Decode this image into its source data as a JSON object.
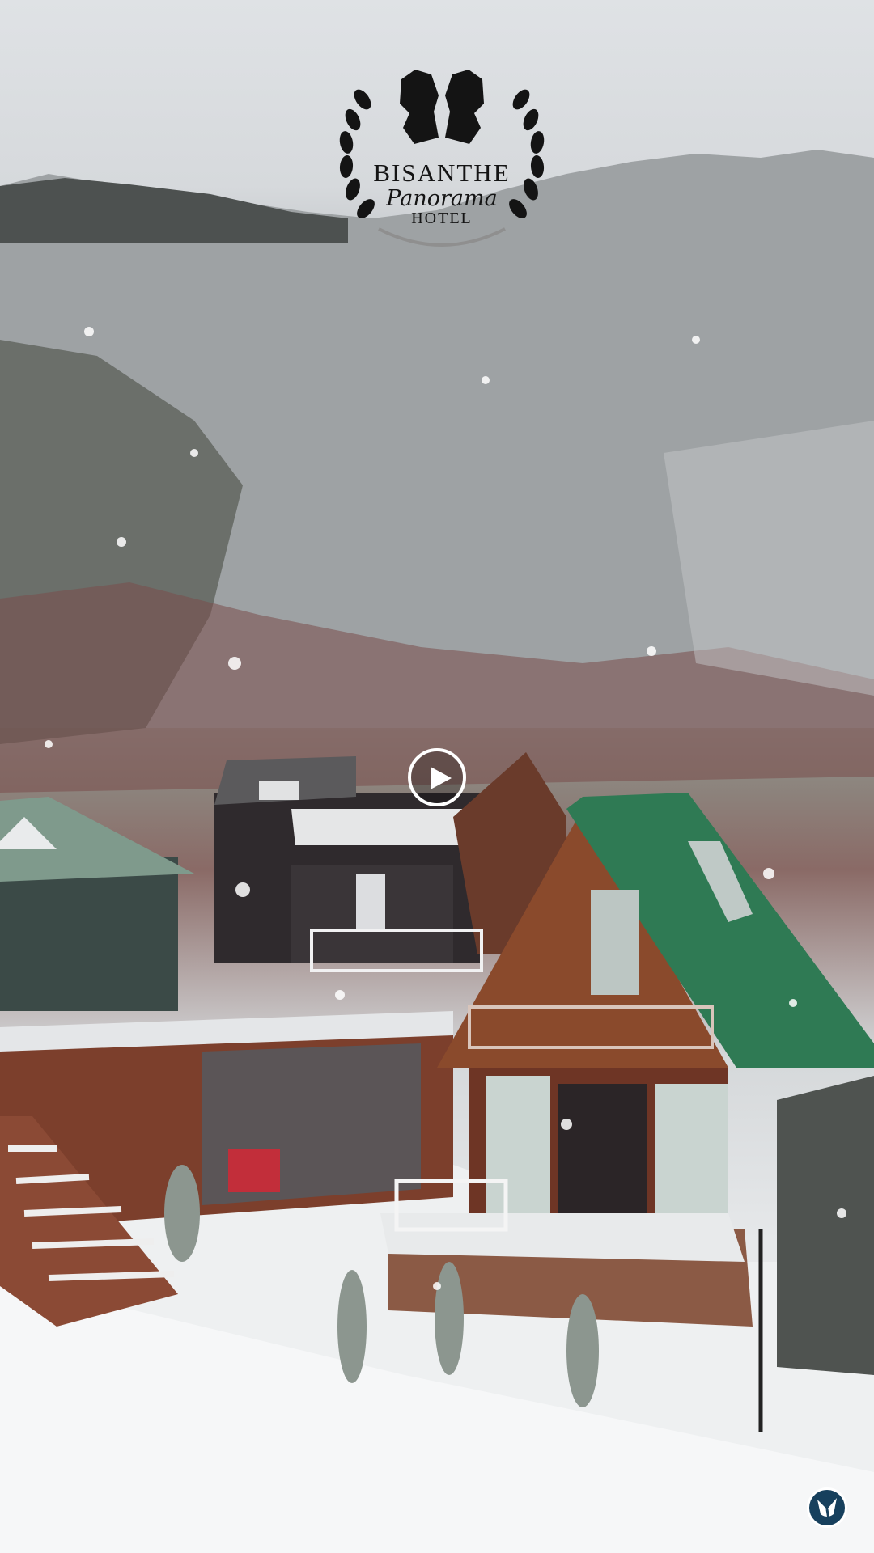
{
  "logo": {
    "line1": "BISANTHE",
    "line2": "Panorama",
    "line3": "HOTEL",
    "icon": "horse-heads-laurel-icon"
  },
  "video": {
    "scene": "snowy-cabins-forest",
    "play_icon": "play-icon"
  },
  "badge": {
    "icon": "app-watermark-icon",
    "color": "#17405d"
  },
  "colors": {
    "roof_green": "#2f7a54",
    "wood": "#8a4a2c",
    "dark_wood": "#2f2a2d",
    "snow": "#eef0f1"
  }
}
